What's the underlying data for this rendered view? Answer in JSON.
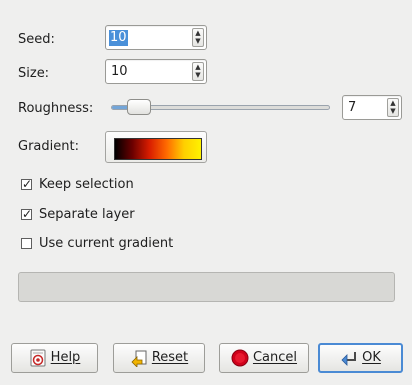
{
  "form": {
    "seed": {
      "label": "Seed:",
      "value": "10"
    },
    "size": {
      "label": "Size:",
      "value": "10"
    },
    "roughness": {
      "label": "Roughness:",
      "value": "7",
      "level": 0.13
    },
    "gradient": {
      "label": "Gradient:"
    }
  },
  "options": [
    {
      "label": "Keep selection",
      "checked": true
    },
    {
      "label": "Separate layer",
      "checked": true
    },
    {
      "label": "Use current gradient",
      "checked": false
    }
  ],
  "buttons": {
    "help": "Help",
    "reset": "Reset",
    "cancel": "Cancel",
    "ok": "OK"
  },
  "icons": {
    "spin_up": "chevron-up-icon",
    "spin_down": "chevron-down-icon",
    "help": "help-icon",
    "reset": "reset-icon",
    "cancel": "stop-icon",
    "ok": "ok-icon"
  },
  "colors": {
    "selection": "#4a90d9",
    "slider_fill": "#73a5d8",
    "default_button_border": "#4a8ad4",
    "gradient_stops": [
      "#000000",
      "#6a0000",
      "#d81d00",
      "#ff6a00",
      "#ffce00",
      "#fff200"
    ]
  }
}
